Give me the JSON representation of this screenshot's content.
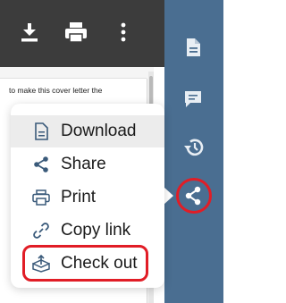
{
  "toolbar": {
    "icons": [
      "download-icon",
      "print-icon",
      "more-vertical-icon"
    ]
  },
  "document": {
    "visible_text": "to make this cover letter the"
  },
  "sidebar": {
    "items": [
      {
        "name": "document-icon"
      },
      {
        "name": "comment-icon"
      },
      {
        "name": "history-icon"
      },
      {
        "name": "share-icon"
      }
    ],
    "highlight_color": "#e11d26",
    "background": "#4a6e91"
  },
  "menu": {
    "items": [
      {
        "label": "Download",
        "icon": "file-icon"
      },
      {
        "label": "Share",
        "icon": "share-icon"
      },
      {
        "label": "Print",
        "icon": "printer-icon"
      },
      {
        "label": "Copy link",
        "icon": "link-icon"
      },
      {
        "label": "Check out",
        "icon": "checkout-box-icon"
      }
    ],
    "active_item": "Download",
    "highlighted_item": "Check out"
  }
}
